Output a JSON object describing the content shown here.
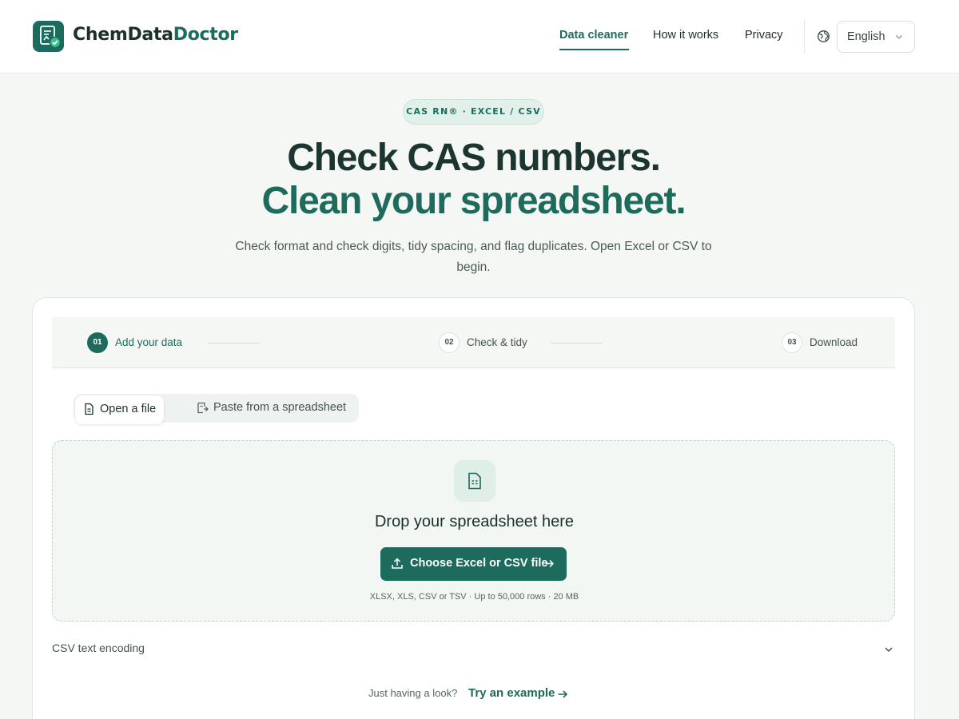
{
  "brand": {
    "part1": "ChemData",
    "part2": "Doctor"
  },
  "nav": {
    "items": [
      {
        "label": "Data cleaner",
        "active": true
      },
      {
        "label": "How it works",
        "active": false
      },
      {
        "label": "Privacy",
        "active": false
      }
    ],
    "language": "English"
  },
  "hero": {
    "pill": "CAS RN® · EXCEL / CSV",
    "title_line1": "Check CAS numbers.",
    "title_line2": "Clean your spreadsheet.",
    "subtitle": "Check format and check digits, tidy spacing, and flag duplicates. Open Excel or CSV to begin."
  },
  "steps": [
    {
      "num": "01",
      "label": "Add your data",
      "active": true
    },
    {
      "num": "02",
      "label": "Check & tidy",
      "active": false
    },
    {
      "num": "03",
      "label": "Download",
      "active": false
    }
  ],
  "tabs": [
    {
      "label": "Open a file",
      "active": true
    },
    {
      "label": "Paste from a spreadsheet",
      "active": false
    }
  ],
  "dropzone": {
    "title": "Drop your spreadsheet here",
    "button": "Choose Excel or CSV file",
    "note": "XLSX, XLS, CSV or TSV · Up to 50,000 rows · 20 MB"
  },
  "encoding": {
    "label": "CSV text encoding"
  },
  "example": {
    "prompt": "Just having a look?",
    "link": "Try an example"
  },
  "colors": {
    "accent": "#1d6b5c",
    "dark_text": "#1c2f2b",
    "background": "#f5f7f5",
    "pill_bg": "#e2f0ea"
  },
  "icons": [
    "logo-icon",
    "globe-icon",
    "chevron-down-icon",
    "file-icon",
    "clipboard-icon",
    "spreadsheet-icon",
    "upload-icon",
    "arrow-right-icon"
  ]
}
